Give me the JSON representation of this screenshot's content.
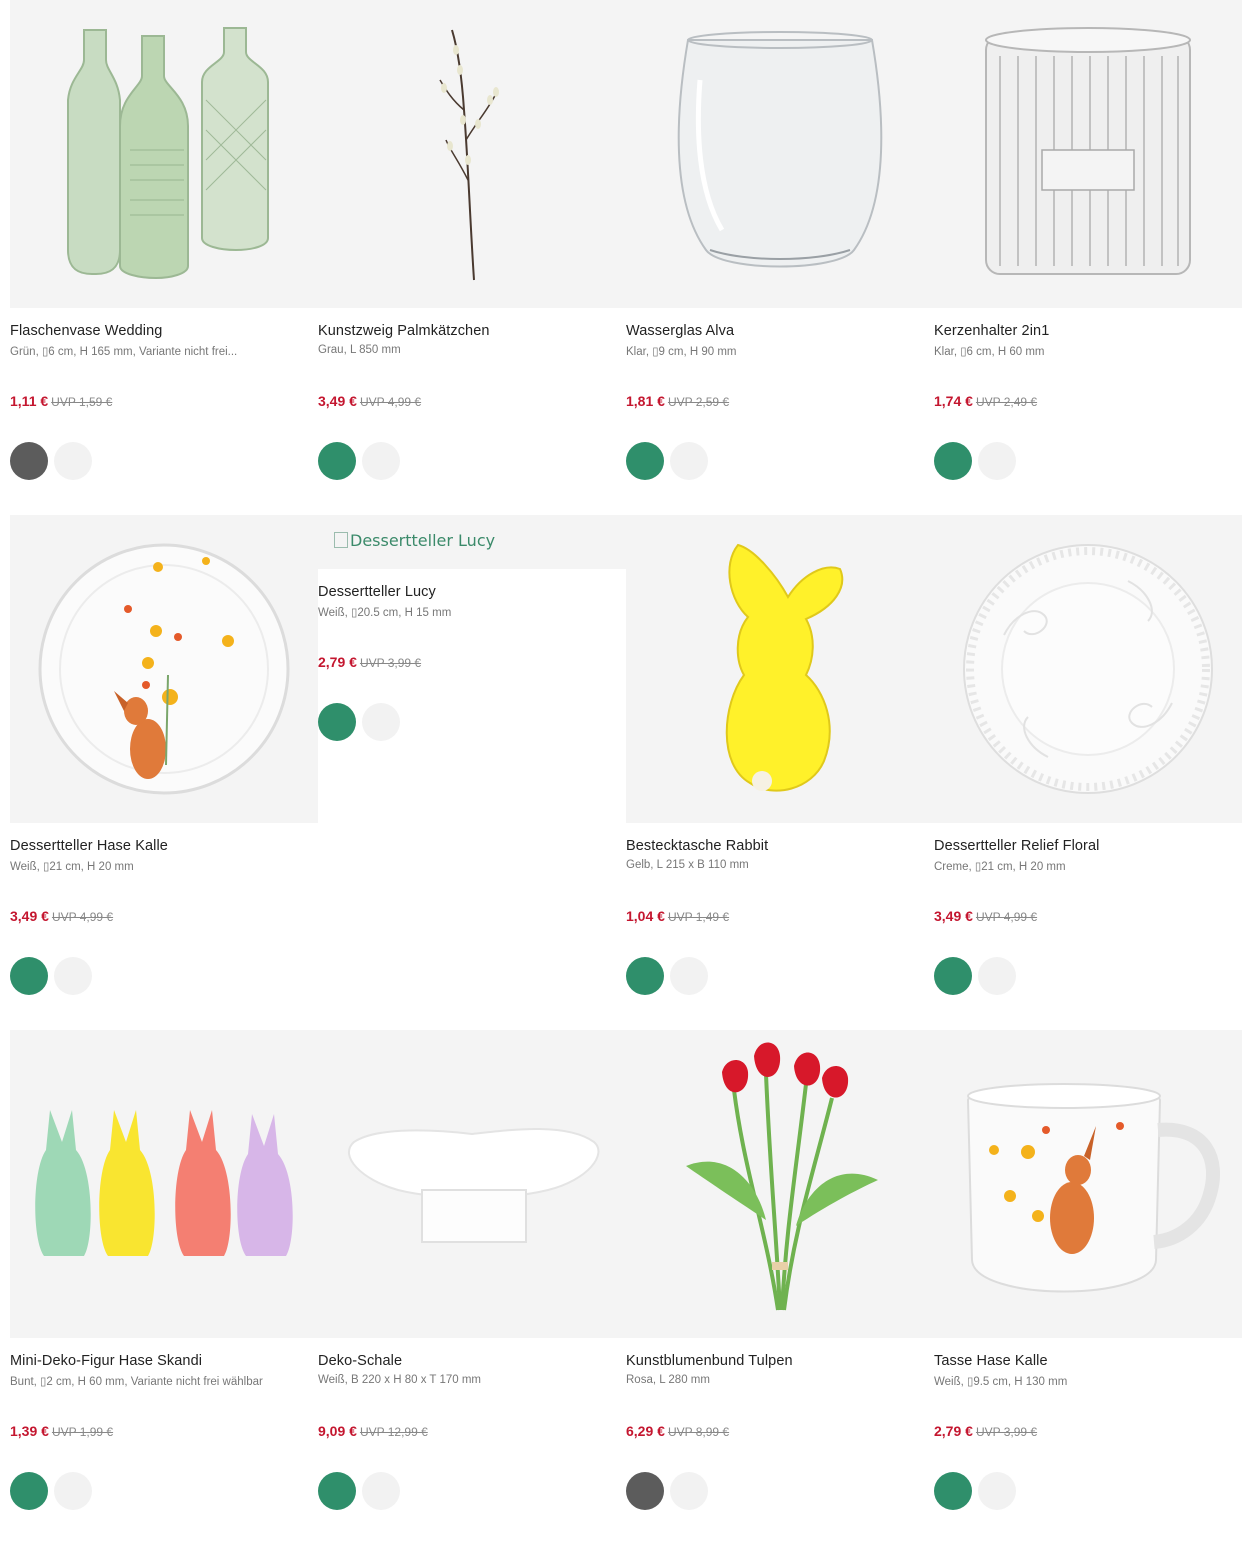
{
  "currency": "€",
  "uvp_prefix": "UVP",
  "colors": {
    "price": "#c4162f",
    "accent_green": "#2f8f6b",
    "swatch_grey": "#5c5c5c",
    "swatch_light": "#f2f2f2"
  },
  "products": [
    {
      "name": "Flaschenvase Wedding",
      "details": "Grün, ▯6 cm, H 165 mm, Variante nicht frei...",
      "price": "1,11 €",
      "uvp": "UVP 1,59 €",
      "swatch_primary": "grey",
      "image_icon": "glass-bottles-icon"
    },
    {
      "name": "Kunstzweig Palmkätzchen",
      "details": "Grau, L 850 mm",
      "price": "3,49 €",
      "uvp": "UVP 4,99 €",
      "swatch_primary": "green",
      "image_icon": "pussy-willow-branch-icon"
    },
    {
      "name": "Wasserglas Alva",
      "details": "Klar, ▯9 cm, H 90 mm",
      "price": "1,81 €",
      "uvp": "UVP 2,59 €",
      "swatch_primary": "green",
      "image_icon": "drinking-glass-icon"
    },
    {
      "name": "Kerzenhalter 2in1",
      "details": "Klar, ▯6 cm, H 60 mm",
      "price": "1,74 €",
      "uvp": "UVP 2,49 €",
      "swatch_primary": "green",
      "image_icon": "candle-holder-icon"
    },
    {
      "name": "Dessertteller Hase Kalle",
      "details": "Weiß, ▯21 cm, H 20 mm",
      "price": "3,49 €",
      "uvp": "UVP 4,99 €",
      "swatch_primary": "green",
      "image_icon": "bunny-plate-icon"
    },
    {
      "name": "Dessertteller Lucy",
      "details": "Weiß, ▯20.5 cm, H 15 mm",
      "price": "2,79 €",
      "uvp": "UVP 3,99 €",
      "swatch_primary": "green",
      "image_alt": "Dessertteller Lucy",
      "image_icon": "broken-image-icon"
    },
    {
      "name": "Bestecktasche Rabbit",
      "details": "Gelb, L 215 x B 110 mm",
      "price": "1,04 €",
      "uvp": "UVP 1,49 €",
      "swatch_primary": "green",
      "image_icon": "felt-bunny-pouch-icon"
    },
    {
      "name": "Dessertteller Relief Floral",
      "details": "Creme, ▯21 cm, H 20 mm",
      "price": "3,49 €",
      "uvp": "UVP 4,99 €",
      "swatch_primary": "green",
      "image_icon": "relief-plate-icon"
    },
    {
      "name": "Mini-Deko-Figur Hase Skandi",
      "details": "Bunt, ▯2 cm, H 60 mm, Variante nicht frei wählbar",
      "price": "1,39 €",
      "uvp": "UVP 1,99 €",
      "swatch_primary": "green",
      "image_icon": "bunny-figures-icon"
    },
    {
      "name": "Deko-Schale",
      "details": "Weiß, B 220 x H 80 x T 170 mm",
      "price": "9,09 €",
      "uvp": "UVP 12,99 €",
      "swatch_primary": "green",
      "image_icon": "deco-bowl-icon"
    },
    {
      "name": "Kunstblumenbund Tulpen",
      "details": "Rosa, L 280 mm",
      "price": "6,29 €",
      "uvp": "UVP 8,99 €",
      "swatch_primary": "grey",
      "image_icon": "tulip-bouquet-icon"
    },
    {
      "name": "Tasse Hase Kalle",
      "details": "Weiß, ▯9.5 cm, H 130 mm",
      "price": "2,79 €",
      "uvp": "UVP 3,99 €",
      "swatch_primary": "green",
      "image_icon": "bunny-mug-icon"
    }
  ]
}
